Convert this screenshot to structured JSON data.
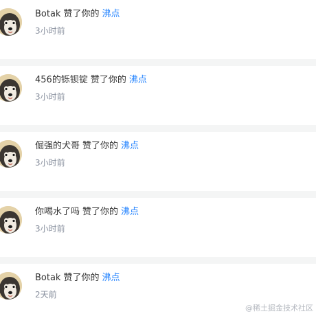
{
  "notifications": [
    {
      "user": "Botak",
      "action": "赞了你的",
      "target": "沸点",
      "time": "3小时前",
      "avatar_icon": "dog-avatar-icon"
    },
    {
      "user": "456的铄钡锭",
      "action": "赞了你的",
      "target": "沸点",
      "time": "3小时前",
      "avatar_icon": "dog-avatar-icon"
    },
    {
      "user": "倔强的犬哥",
      "action": "赞了你的",
      "target": "沸点",
      "time": "3小时前",
      "avatar_icon": "dog-avatar-icon"
    },
    {
      "user": "你喝水了吗",
      "action": "赞了你的",
      "target": "沸点",
      "time": "3小时前",
      "avatar_icon": "dog-avatar-icon"
    },
    {
      "user": "Botak",
      "action": "赞了你的",
      "target": "沸点",
      "time": "2天前",
      "avatar_icon": "dog-avatar-icon"
    }
  ],
  "watermark": "@稀土掘金技术社区",
  "colors": {
    "link": "#1e80ff",
    "text": "#333333",
    "muted": "#8a919f",
    "separator": "#f4f5f5"
  }
}
